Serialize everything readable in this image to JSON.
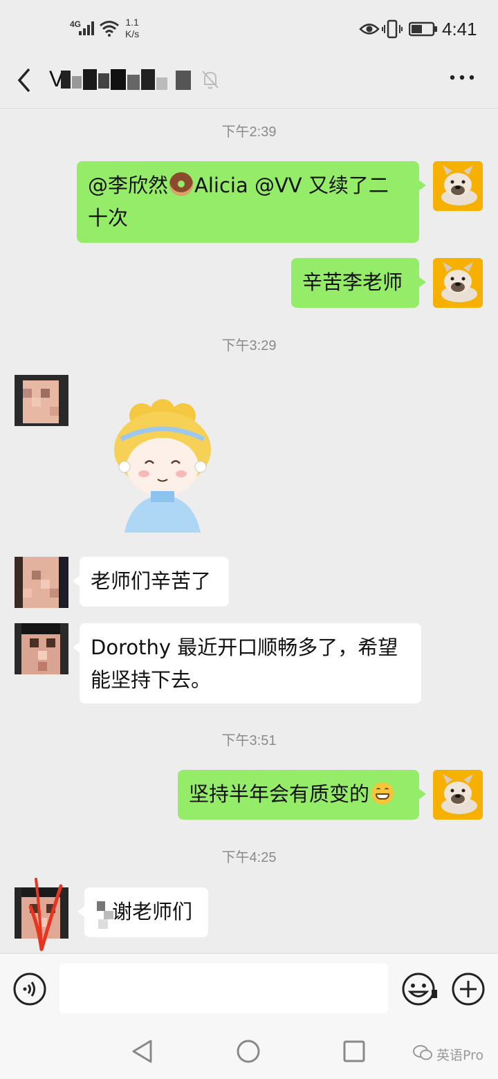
{
  "status_bar": {
    "network": "4G",
    "speed_value": "1.1",
    "speed_unit": "K/s",
    "time": "4:41"
  },
  "header": {
    "chat_title": "V"
  },
  "messages": [
    {
      "type": "time",
      "text": "下午2:39"
    },
    {
      "type": "me",
      "line1": "@李欣然",
      "line1b": "Alicia @VV  又续了二",
      "line2": "十次"
    },
    {
      "type": "me",
      "text": "辛苦李老师"
    },
    {
      "type": "time",
      "text": "下午3:29"
    },
    {
      "type": "other-sticker"
    },
    {
      "type": "other",
      "text": "老师们辛苦了"
    },
    {
      "type": "other",
      "line1": "Dorothy 最近开口顺畅多了，希望",
      "line2": "能坚持下去。"
    },
    {
      "type": "time",
      "text": "下午3:51"
    },
    {
      "type": "me",
      "text": "坚持半年会有质变的"
    },
    {
      "type": "time",
      "text": "下午4:25"
    },
    {
      "type": "other",
      "text": "谢老师们"
    }
  ],
  "watermark": "英语Pro",
  "colors": {
    "background": "#ededed",
    "my_bubble": "#95ec69",
    "other_bubble": "#ffffff",
    "avatar_me": "#f6b100",
    "red_mark": "#e8351f"
  }
}
